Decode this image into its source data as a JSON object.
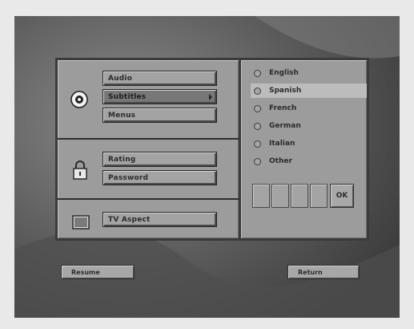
{
  "menu": {
    "disc_group": {
      "icon": "disc-icon",
      "buttons": [
        {
          "label": "Audio"
        },
        {
          "label": "Subtitles",
          "has_submenu": true
        },
        {
          "label": "Menus"
        }
      ]
    },
    "lock_group": {
      "icon": "lock-icon",
      "buttons": [
        {
          "label": "Rating"
        },
        {
          "label": "Password"
        }
      ]
    },
    "tv_group": {
      "icon": "tv-icon",
      "buttons": [
        {
          "label": "TV Aspect"
        }
      ]
    }
  },
  "language_panel": {
    "options": [
      {
        "label": "English",
        "selected": false
      },
      {
        "label": "Spanish",
        "selected": true
      },
      {
        "label": "French",
        "selected": false
      },
      {
        "label": "German",
        "selected": false
      },
      {
        "label": "Italian",
        "selected": false
      },
      {
        "label": "Other",
        "selected": false
      }
    ],
    "ok_label": "OK"
  },
  "footer": {
    "resume_label": "Resume",
    "return_label": "Return"
  }
}
